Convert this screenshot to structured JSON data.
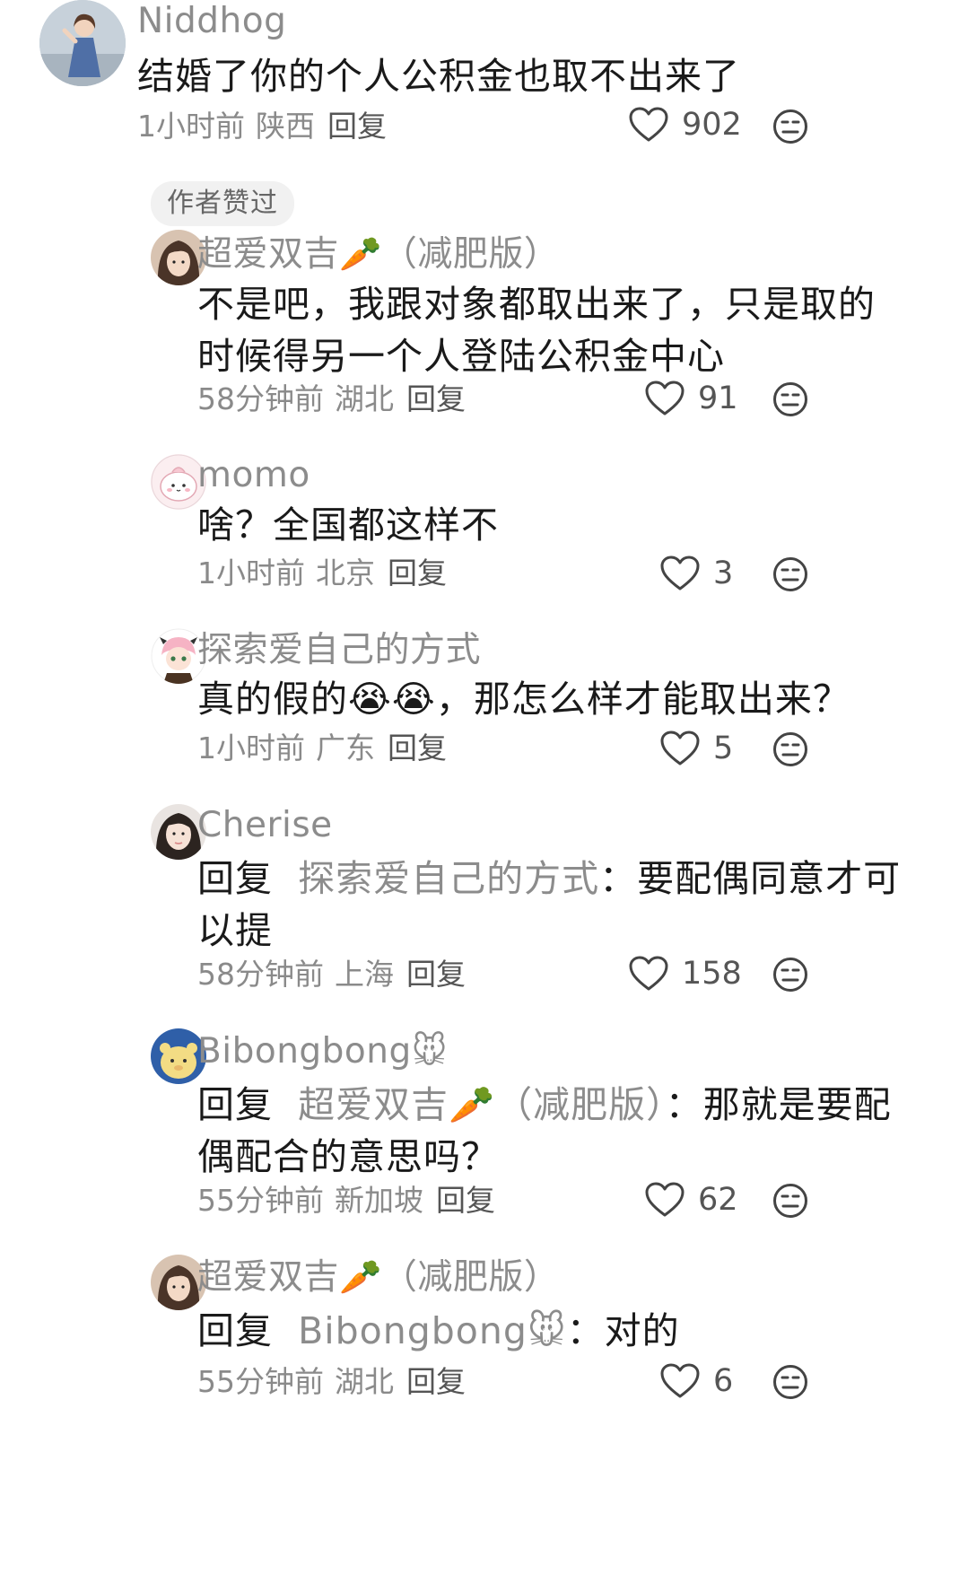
{
  "comments": [
    {
      "nick": "Niddhog",
      "text": "结婚了你的个人公积金也取不出来了",
      "time": "1小时前",
      "location": "陕西",
      "reply_label": "回复",
      "likes": "902",
      "badge": "作者赞过"
    },
    {
      "nick": "超爱双吉",
      "nick_emoji": "🥕",
      "nick_suffix": "（减肥版）",
      "text_line1": "不是吧，我跟对象都取出来了，只是取的",
      "text_line2": "时候得另一个人登陆公积金中心",
      "time": "58分钟前",
      "location": "湖北",
      "reply_label": "回复",
      "likes": "91"
    },
    {
      "nick": "momo",
      "text": "啥？全国都这样不",
      "time": "1小时前",
      "location": "北京",
      "reply_label": "回复",
      "likes": "3"
    },
    {
      "nick": "探索爱自己的方式",
      "text_before": "真的假的",
      "text_emoji": "😭😭",
      "text_after": "，那怎么样才能取出来？",
      "time": "1小时前",
      "location": "广东",
      "reply_label": "回复",
      "likes": "5"
    },
    {
      "nick": "Cherise",
      "reply_kw": "回复",
      "reply_target": "探索爱自己的方式",
      "text_line1_rest": "：要配偶同意才可",
      "text_line2": "以提",
      "time": "58分钟前",
      "location": "上海",
      "reply_label": "回复",
      "likes": "158"
    },
    {
      "nick": "Bibongbong",
      "nick_emoji": "🐭",
      "reply_kw": "回复",
      "reply_target": "超爱双吉",
      "reply_target_emoji": "🥕",
      "reply_target_suffix": "（减肥版）",
      "text_line1_rest": "：那就是要配",
      "text_line2": "偶配合的意思吗？",
      "time": "55分钟前",
      "location": "新加坡",
      "reply_label": "回复",
      "likes": "62"
    },
    {
      "nick": "超爱双吉",
      "nick_emoji": "🥕",
      "nick_suffix": "（减肥版）",
      "reply_kw": "回复",
      "reply_target": "Bibongbong",
      "reply_target_emoji": "🐭",
      "text_line1_rest": "：对的",
      "time": "55分钟前",
      "location": "湖北",
      "reply_label": "回复",
      "likes": "6"
    }
  ]
}
